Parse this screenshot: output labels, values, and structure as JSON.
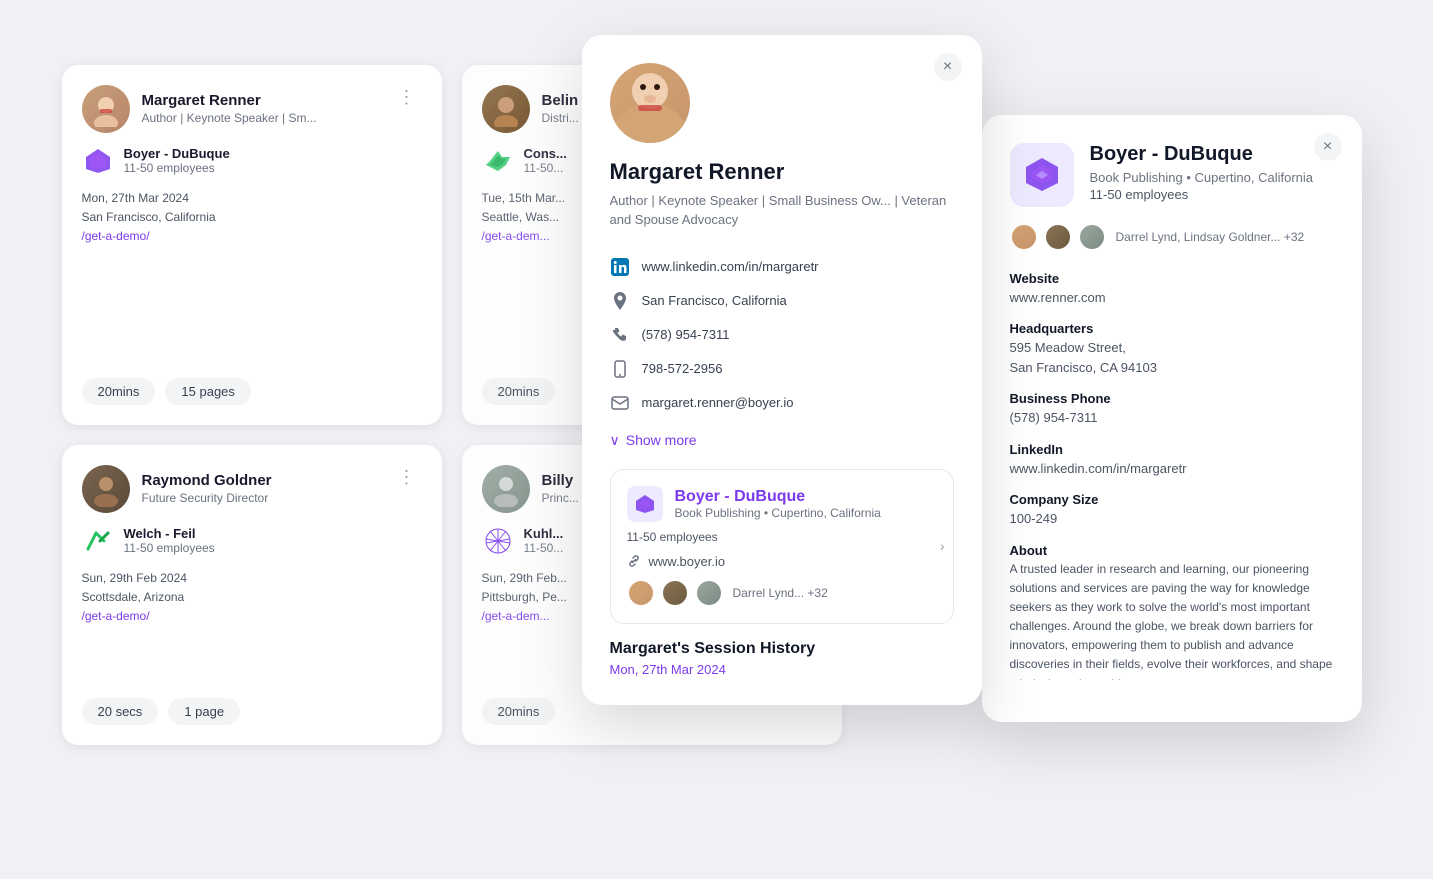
{
  "cards": [
    {
      "id": "margaret",
      "name": "Margaret Renner",
      "title": "Author | Keynote Speaker | Sm...",
      "company_name": "Boyer - DuBuque",
      "company_size": "11-50 employees",
      "date": "Mon, 27th Mar 2024",
      "location": "San Francisco, California",
      "link": "/get-a-demo/",
      "duration": "20mins",
      "pages": "15 pages"
    },
    {
      "id": "belin",
      "name": "Belin",
      "title": "Distri...",
      "company_name": "Cons...",
      "company_size": "11-50...",
      "date": "Tue, 15th Mar...",
      "location": "Seattle, Was...",
      "link": "/get-a-dem...",
      "duration": "20mins",
      "pages": null
    },
    {
      "id": "raymond",
      "name": "Raymond Goldner",
      "title": "Future Security Director",
      "company_name": "Welch - Feil",
      "company_size": "11-50 employees",
      "date": "Sun, 29th Feb 2024",
      "location": "Scottsdale, Arizona",
      "link": "/get-a-demo/",
      "duration": "20 secs",
      "pages": "1 page"
    },
    {
      "id": "billy",
      "name": "Billy",
      "title": "Princ...",
      "company_name": "Kuhl...",
      "company_size": "11-50...",
      "date": "Sun, 29th Feb...",
      "location": "Pittsburgh, Pe...",
      "link": "/get-a-dem...",
      "duration": "20mins",
      "pages": null
    }
  ],
  "profile_modal": {
    "name": "Margaret Renner",
    "title": "Author | Keynote Speaker | Small Business Ow... | Veteran and Spouse Advocacy",
    "linkedin": "www.linkedin.com/in/margaretr",
    "location": "San Francisco, California",
    "phone": "(578) 954-7311",
    "mobile": "798-572-2956",
    "email": "margaret.renner@boyer.io",
    "show_more": "Show more",
    "close_label": "×",
    "company_section": {
      "name": "Boyer - DuBuque",
      "industry": "Book Publishing • Cupertino, California",
      "employees": "11-50 employees",
      "website": "www.boyer.io",
      "team": "Darrel Lynd... +32"
    },
    "session_title": "Margaret's Session History",
    "session_date": "Mon, 27th Mar 2024"
  },
  "company_panel": {
    "name": "Boyer - DuBuque",
    "industry": "Book Publishing • Cupertino, California",
    "employees": "11-50 employees",
    "team_label": "Darrel Lynd, Lindsay Goldner... +32",
    "close_label": "×",
    "website_label": "Website",
    "website_value": "www.renner.com",
    "headquarters_label": "Headquarters",
    "headquarters_value": "595 Meadow Street,\nSan Francisco, CA 94103",
    "business_phone_label": "Business Phone",
    "business_phone_value": "(578) 954-7311",
    "linkedin_label": "LinkedIn",
    "linkedin_value": "www.linkedin.com/in/margaretr",
    "company_size_label": "Company Size",
    "company_size_value": "100-249",
    "about_label": "About",
    "about_text": "A trusted leader in research and learning, our pioneering solutions and services are paving the way for knowledge seekers as they work to solve the world's most important challenges. Around the globe, we break down barriers for innovators, empowering them to publish and advance discoveries in their fields, evolve their workforces, and shape minds through teaching..."
  }
}
